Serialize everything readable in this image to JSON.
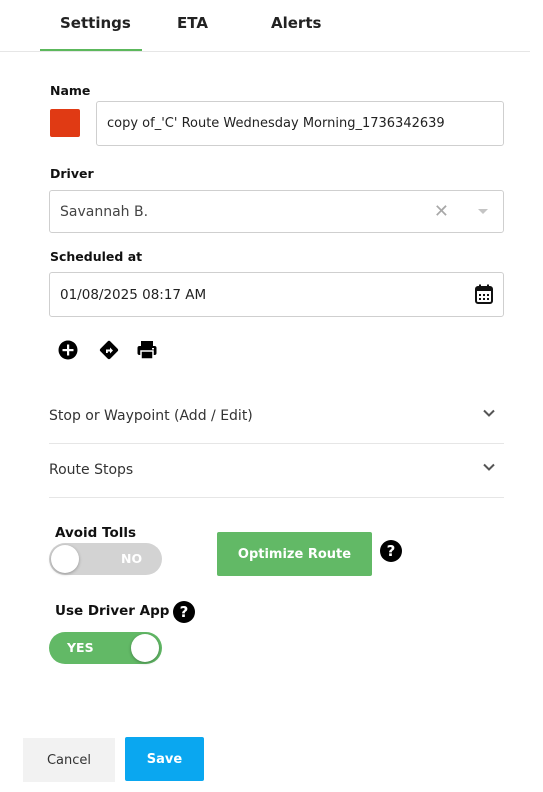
{
  "tabs": [
    {
      "label": "Settings",
      "active": true
    },
    {
      "label": "ETA",
      "active": false
    },
    {
      "label": "Alerts",
      "active": false
    }
  ],
  "accent_color": "#5cb85c",
  "name": {
    "label": "Name",
    "value": "copy of_'C' Route Wednesday Morning_1736342639",
    "swatch_color": "#e03a14"
  },
  "driver": {
    "label": "Driver",
    "value": "Savannah B."
  },
  "scheduled": {
    "label": "Scheduled at",
    "value": "01/08/2025 08:17 AM"
  },
  "tools": [
    "add-circle-icon",
    "directions-icon",
    "print-icon"
  ],
  "accordions": [
    {
      "label": "Stop or Waypoint (Add / Edit)"
    },
    {
      "label": "Route Stops"
    }
  ],
  "avoid_tolls": {
    "label": "Avoid Tolls",
    "state": "NO",
    "on": false
  },
  "optimize": {
    "label": "Optimize Route",
    "color": "#62b966"
  },
  "use_driver_app": {
    "label": "Use Driver App",
    "state": "YES",
    "on": true
  },
  "footer": {
    "cancel_label": "Cancel",
    "save_label": "Save",
    "save_color": "#0aa7f0"
  }
}
